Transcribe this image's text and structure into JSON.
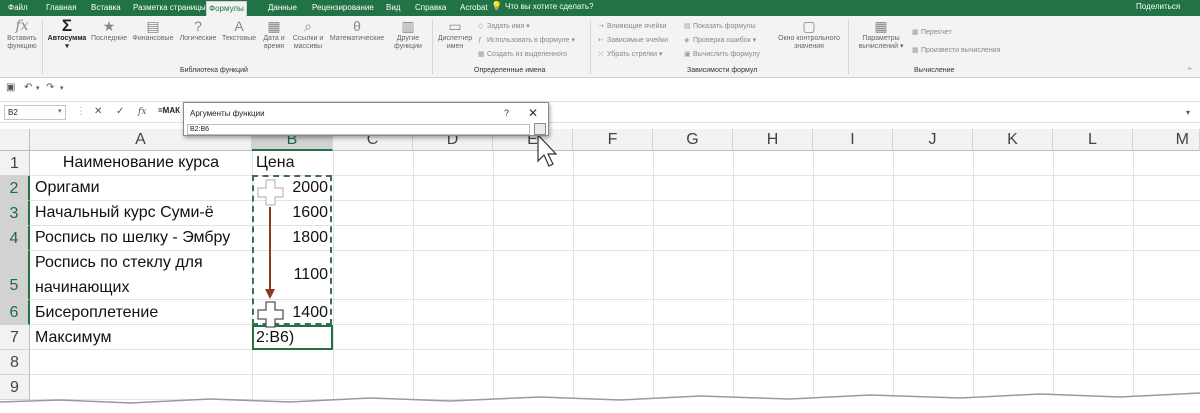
{
  "tabs": [
    "Файл",
    "Главная",
    "Вставка",
    "Разметка страницы",
    "Формулы",
    "Данные",
    "Рецензирование",
    "Вид",
    "Справка",
    "Acrobat"
  ],
  "active_tab": "Формулы",
  "tell_me": "Что вы хотите сделать?",
  "share": "Поделиться",
  "ribbon": {
    "insert_function": [
      "Вставить",
      "функцию"
    ],
    "autosum": "Автосумма",
    "recent": "Последние",
    "financial": "Финансовые",
    "logical": "Логические",
    "text": "Текстовые",
    "datetime": [
      "Дата и",
      "время"
    ],
    "lookup": [
      "Ссылки и",
      "массивы"
    ],
    "math": "Математические",
    "more": [
      "Другие",
      "функции"
    ],
    "group_library": "Библиотека функций",
    "name_manager": [
      "Диспетчер",
      "имен"
    ],
    "define_name": "Задать имя",
    "use_in_formula": "Использовать в формуле",
    "create_from_selection": "Создать из выделенного",
    "group_names": "Определенные имена",
    "trace_precedents": "Влияющие ячейки",
    "trace_dependents": "Зависимые ячейки",
    "remove_arrows": "Убрать стрелки",
    "show_formulas": "Показать формулы",
    "error_checking": "Проверка ошибок",
    "evaluate_formula": "Вычислить формулу",
    "watch_window": [
      "Окно контрольного",
      "значения"
    ],
    "group_audit": "Зависимости формул",
    "calc_options": [
      "Параметры",
      "вычислений"
    ],
    "calc_now": "Пересчет",
    "calc_sheet": "Произвести вычисления",
    "group_calc": "Вычисление"
  },
  "formula_bar": {
    "name_box": "B2",
    "formula": "=МАК",
    "fx": "fx"
  },
  "dialog": {
    "title": "Аргументы функции",
    "help": "?",
    "close": "✕",
    "input": "B2:B6"
  },
  "columns": [
    "A",
    "B",
    "C",
    "D",
    "E",
    "F",
    "G",
    "H",
    "I",
    "J",
    "K",
    "L",
    "M"
  ],
  "rows": [
    "1",
    "2",
    "3",
    "4",
    "5",
    "6",
    "7",
    "8",
    "9"
  ],
  "cells": {
    "a1": "Наименование курса",
    "b1": "Цена",
    "a2": "Оригами",
    "b2": "2000",
    "a3": "Начальный курс Суми-ё",
    "b3": "1600",
    "a4": "Роспись по шелку - Эмбру",
    "b4": "1800",
    "a5_line1": "Роспись по стеклу для",
    "a5_line2": "начинающих",
    "b5": "1100",
    "a6": "Бисероплетение",
    "b6": "1400",
    "a7": "Максимум",
    "b7": "2:B6)"
  },
  "colors": {
    "excel_green": "#217346",
    "arrow": "#8b3a1f"
  }
}
